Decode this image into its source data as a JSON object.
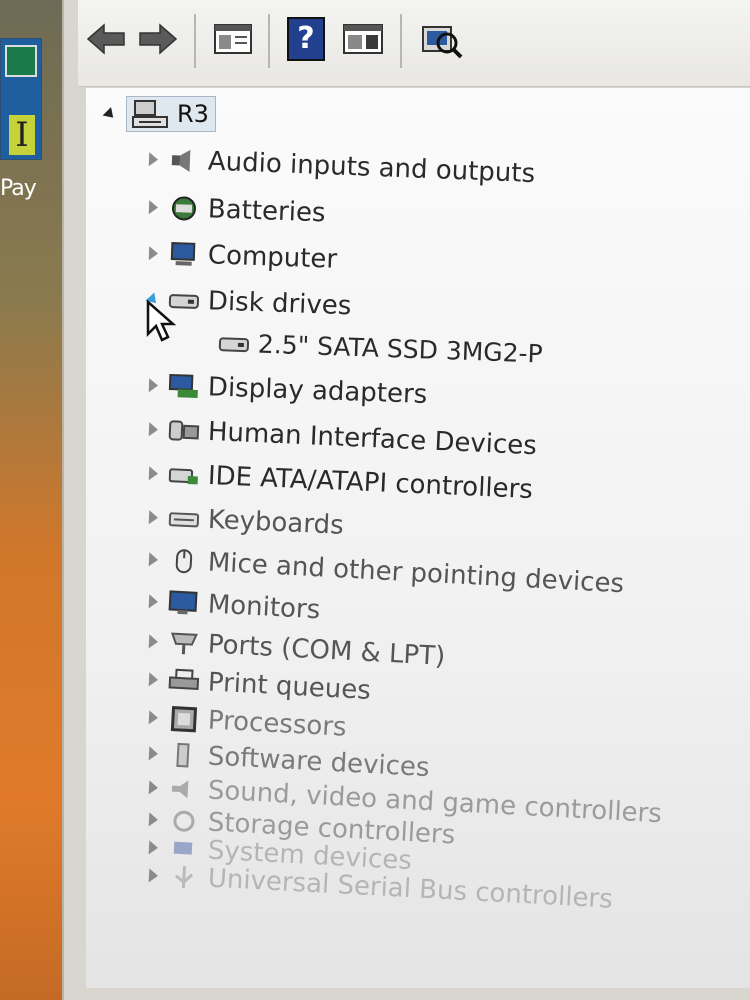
{
  "desktop": {
    "label": "Pay"
  },
  "toolbar": {
    "buttons": [
      {
        "name": "back-arrow-icon"
      },
      {
        "name": "forward-arrow-icon"
      },
      {
        "name": "properties-icon"
      },
      {
        "name": "help-icon",
        "glyph": "?"
      },
      {
        "name": "update-driver-icon"
      },
      {
        "name": "scan-hardware-icon"
      }
    ]
  },
  "tree": {
    "root_label": "R3",
    "categories": [
      {
        "label": "Audio inputs and outputs",
        "icon": "speaker-icon"
      },
      {
        "label": "Batteries",
        "icon": "battery-icon"
      },
      {
        "label": "Computer",
        "icon": "computer-icon"
      },
      {
        "label": "Disk drives",
        "icon": "disk-drive-icon",
        "expanded": true,
        "children": [
          {
            "label": "2.5\" SATA SSD 3MG2-P",
            "icon": "disk-drive-icon"
          }
        ]
      },
      {
        "label": "Display adapters",
        "icon": "display-adapter-icon"
      },
      {
        "label": "Human Interface Devices",
        "icon": "hid-icon"
      },
      {
        "label": "IDE ATA/ATAPI controllers",
        "icon": "ide-controller-icon"
      },
      {
        "label": "Keyboards",
        "icon": "keyboard-icon"
      },
      {
        "label": "Mice and other pointing devices",
        "icon": "mouse-icon"
      },
      {
        "label": "Monitors",
        "icon": "monitor-icon"
      },
      {
        "label": "Ports (COM & LPT)",
        "icon": "port-icon"
      },
      {
        "label": "Print queues",
        "icon": "printer-icon"
      },
      {
        "label": "Processors",
        "icon": "processor-icon"
      },
      {
        "label": "Software devices",
        "icon": "software-device-icon"
      },
      {
        "label": "Sound, video and game controllers",
        "icon": "sound-icon"
      },
      {
        "label": "Storage controllers",
        "icon": "storage-controller-icon"
      },
      {
        "label": "System devices",
        "icon": "system-device-icon"
      },
      {
        "label": "Universal Serial Bus controllers",
        "icon": "usb-icon"
      }
    ]
  },
  "colors": {
    "accent_blue": "#1f5fa0",
    "selection": "#dfe7ef"
  }
}
